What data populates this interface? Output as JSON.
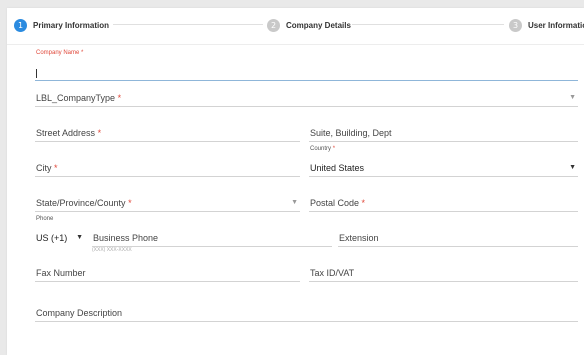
{
  "stepper": {
    "steps": [
      {
        "number": "1",
        "label": "Primary Information"
      },
      {
        "number": "2",
        "label": "Company Details"
      },
      {
        "number": "3",
        "label": "User Informatio"
      }
    ]
  },
  "form": {
    "company_name_label": "Company Name",
    "company_type_label": "LBL_CompanyType",
    "street_address_label": "Street Address",
    "suite_label": "Suite, Building, Dept",
    "city_label": "City",
    "country_label": "Country",
    "country_value": "United States",
    "state_label": "State/Province/County",
    "postal_code_label": "Postal Code",
    "phone_label": "Phone",
    "phone_code_value": "US (+1)",
    "business_phone_label": "Business Phone",
    "business_phone_hint": "(XXX) XXX-XXXX",
    "extension_label": "Extension",
    "fax_label": "Fax Number",
    "tax_label": "Tax ID/VAT",
    "description_label": "Company Description",
    "required_mark": "*"
  },
  "colors": {
    "active_step": "#2b8be0",
    "inactive_step": "#c9c9c9",
    "required": "#e0483a",
    "focus_underline": "#8fb6d9"
  }
}
